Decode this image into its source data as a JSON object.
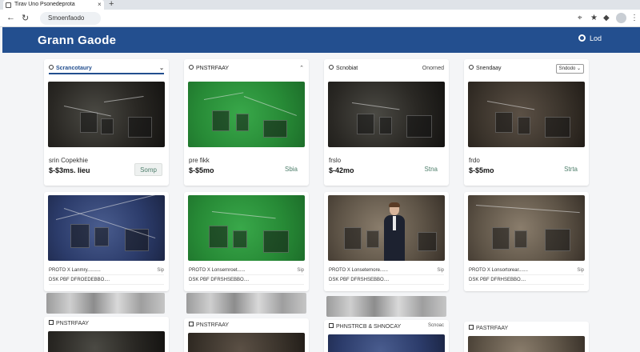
{
  "browser": {
    "tab_title": "Tirav Uno Psonedeprota",
    "tab_close": "×",
    "new_tab": "+",
    "address": "Smoenfaodo",
    "icons": [
      "back-arrow-icon",
      "reload-icon",
      "extension-icon",
      "star-icon",
      "puzzle-icon",
      "profile-icon",
      "menu-icon"
    ]
  },
  "header": {
    "title": "Grann Gaode",
    "action_label": "Lod",
    "accent": "#234f8f"
  },
  "cards": [
    {
      "header": "Scrancotaury",
      "header_right": "⌄",
      "title": "srin Copekhie",
      "price": "$-$3ms. Iieu",
      "action": "Somp",
      "action_boxed": true,
      "photo": "dark"
    },
    {
      "header": "PNSTRFAAY",
      "header_right": "⌃",
      "title": "pre fikk",
      "price": "$-$5mo",
      "action": "Sbia",
      "action_boxed": false,
      "photo": "green"
    },
    {
      "header": "Scnobiat",
      "header_right": "Onorned",
      "title": "frslo",
      "price": "$-42mo",
      "action": "Stna",
      "action_boxed": false,
      "photo": "dark"
    },
    {
      "header": "Snendaay",
      "header_right": "Sndodo ⌄",
      "title": "frdo",
      "price": "$-$5mo",
      "action": "Strta",
      "action_boxed": false,
      "photo": "brown"
    }
  ],
  "row2": [
    {
      "tagline": "PROTO X Lanmry..........",
      "mini": "Sip",
      "photo": "blue"
    },
    {
      "tagline": "PROTO X Lonsernroet......",
      "mini": "Sip",
      "photo": "green"
    },
    {
      "tagline": "PROTO X Lonseternore......",
      "mini": "Sip",
      "photo": "sepia"
    },
    {
      "tagline": "PROTO X Lonsortorear.......",
      "mini": "Sip",
      "photo": "sepia"
    }
  ],
  "row2_sub": [
    "DSK PBF DFROEDEBBO....",
    "DSK PBF DFRSHSEBBO....",
    "DSK PBF DFRSHSEBBO....",
    "DSK PBF DFRHSEBBO...."
  ],
  "bottom_cards": [
    {
      "header": "PNSTRFAAY",
      "right": ""
    },
    {
      "header": "PNSTRFAAY",
      "right": ""
    },
    {
      "header": "PHNSTRCB & SHNOCAY",
      "right": "Scnoac"
    },
    {
      "header": "PASTRFAAY",
      "right": ""
    }
  ]
}
